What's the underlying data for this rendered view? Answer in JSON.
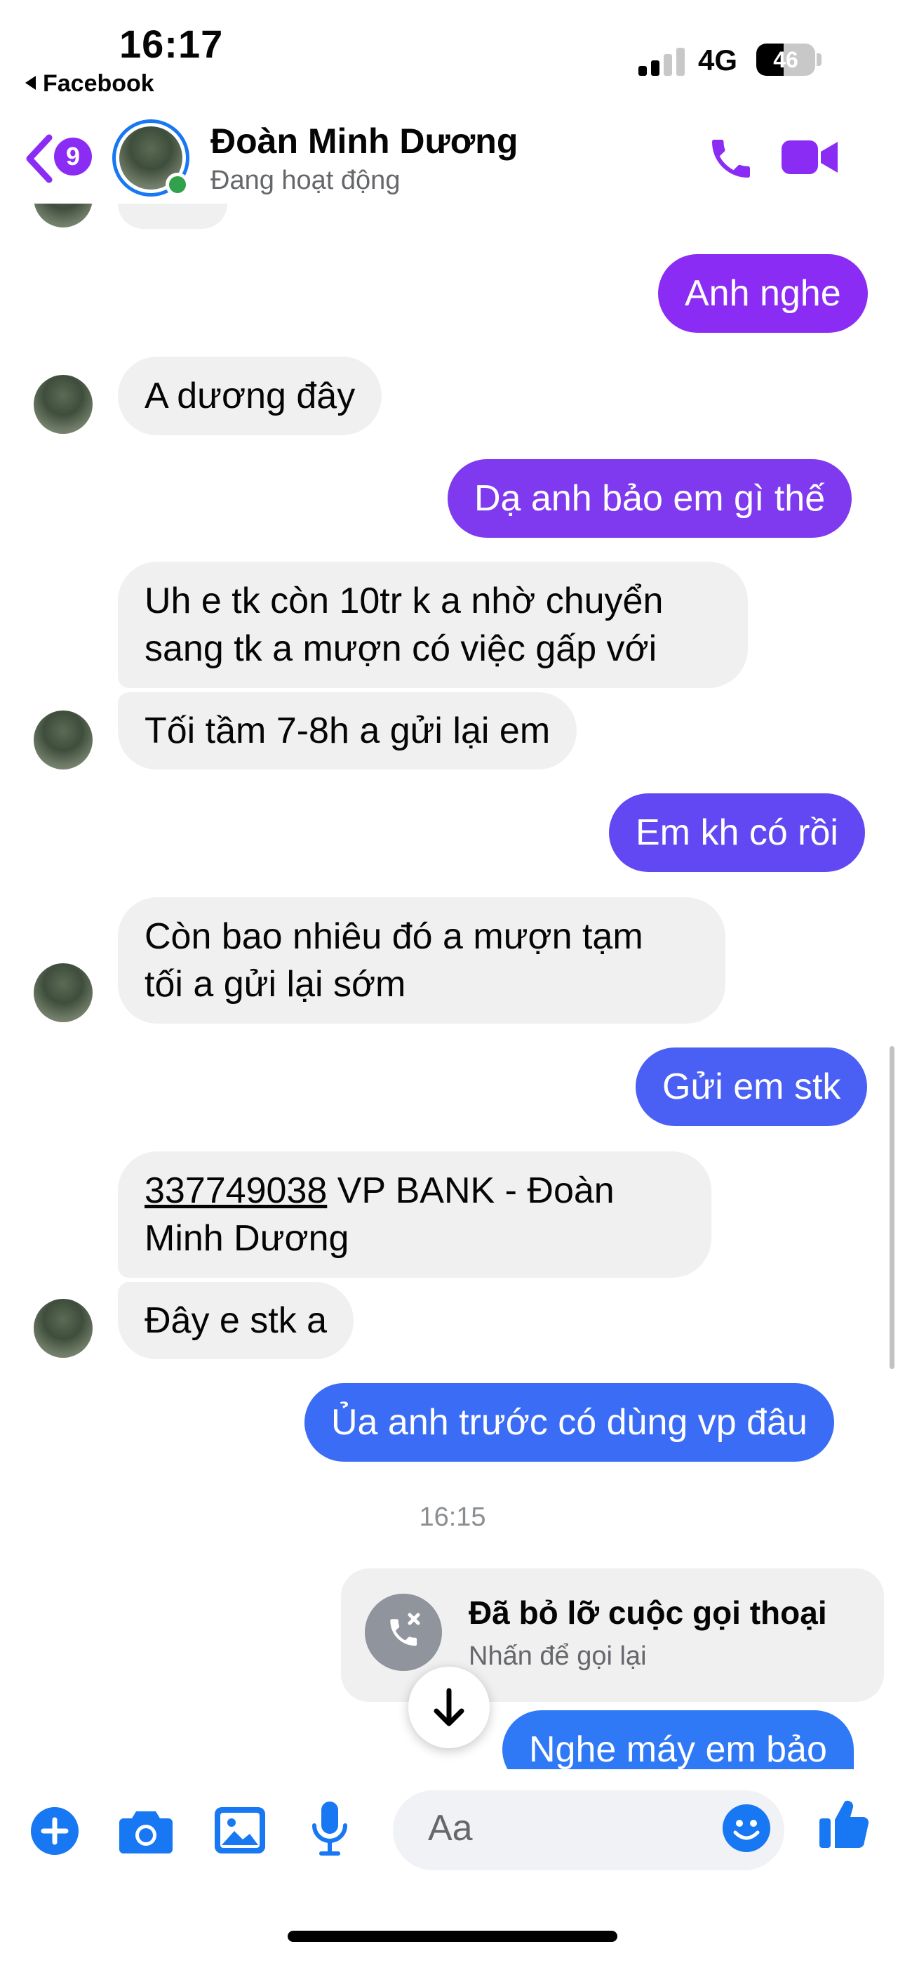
{
  "status_bar": {
    "time": "16:17",
    "back_app": "Facebook",
    "network": "4G",
    "battery": "46",
    "battery_level": 0.46
  },
  "header": {
    "unread_badge": "9",
    "contact_name": "Đoàn Minh Dương",
    "contact_status": "Đang hoạt động"
  },
  "messages": [
    {
      "dir": "out",
      "text": "Anh nghe"
    },
    {
      "dir": "in",
      "text": "A dương đây"
    },
    {
      "dir": "out",
      "text": "Dạ anh bảo em gì thế"
    },
    {
      "dir": "in",
      "lines": [
        "Uh e tk còn 10tr k a nhờ chuyển",
        "sang tk a mượn có việc gấp với"
      ]
    },
    {
      "dir": "in",
      "text": "Tối tầm 7-8h a gửi lại em"
    },
    {
      "dir": "out",
      "text": "Em kh có rồi"
    },
    {
      "dir": "in",
      "lines": [
        "Còn bao nhiêu đó a mượn tạm",
        "tối a gửi lại sớm"
      ]
    },
    {
      "dir": "out",
      "text": "Gửi em stk"
    },
    {
      "dir": "in",
      "account_number": "337749038",
      "line1_rest": " VP BANK - Đoàn",
      "line2": "Minh Dương"
    },
    {
      "dir": "in",
      "text": "Đây e stk a"
    },
    {
      "dir": "out",
      "text": "Ủa anh trước có dùng vp đâu"
    },
    {
      "dir": "out",
      "text": "Nghe máy em bảo"
    }
  ],
  "timestamp": "16:15",
  "missed_call": {
    "title": "Đã bỏ lỡ cuộc gọi thoại",
    "subtitle": "Nhấn để gọi lại"
  },
  "composer": {
    "placeholder": "Aa"
  },
  "colors": {
    "purple": "#8b2cf5",
    "blue": "#1877f2",
    "incoming_bubble": "#f0f0f0",
    "online": "#31a24c"
  }
}
